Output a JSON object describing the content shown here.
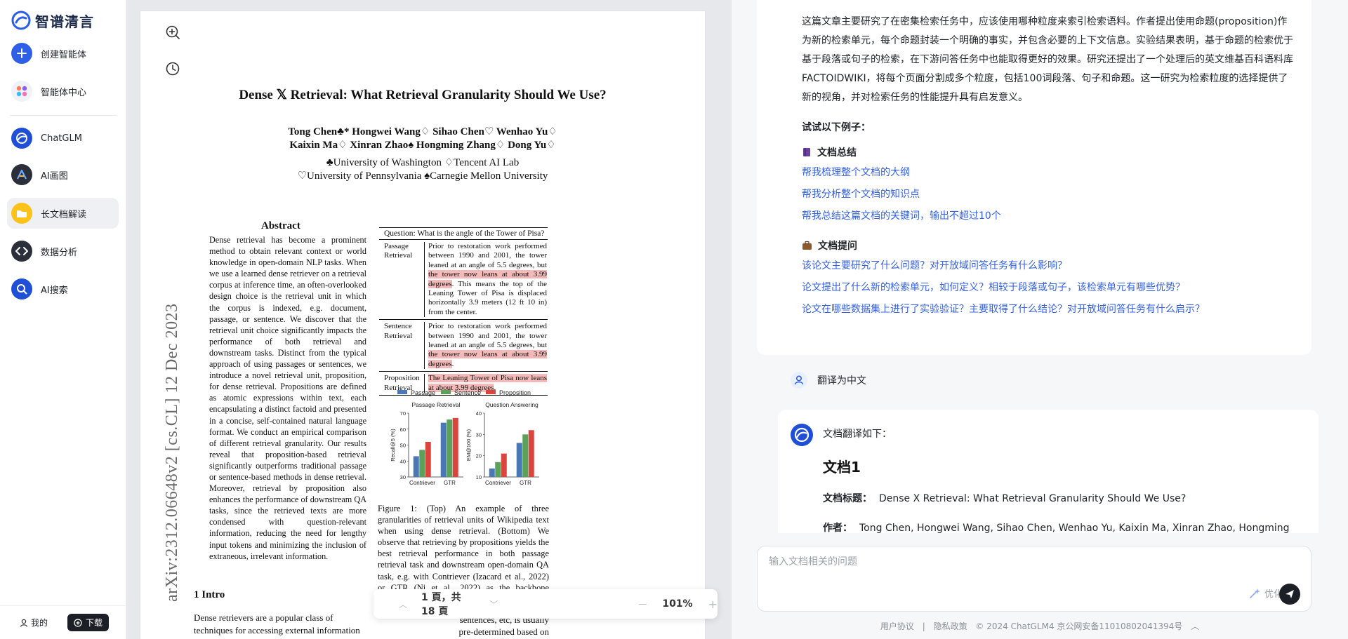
{
  "app": {
    "logo_text": "智谱清言"
  },
  "sidebar": {
    "items": [
      {
        "label": "创建智能体",
        "icon": "plus-icon"
      },
      {
        "label": "智能体中心",
        "icon": "agent-center-icon"
      },
      {
        "label": "ChatGLM",
        "icon": "chatglm-icon"
      },
      {
        "label": "AI画图",
        "icon": "ai-draw-icon"
      },
      {
        "label": "长文档解读",
        "icon": "folder-icon",
        "active": true
      },
      {
        "label": "数据分析",
        "icon": "code-icon"
      },
      {
        "label": "AI搜索",
        "icon": "search-icon"
      }
    ],
    "mine_label": "我的",
    "download_label": "下载"
  },
  "paper": {
    "title": "Dense 𝕏 Retrieval: What Retrieval Granularity Should We Use?",
    "authors_line1": "Tong Chen♣* Hongwei Wang♢ Sihao Chen♡ Wenhao Yu♢",
    "authors_line2": "Kaixin Ma♢ Xinran Zhao♠ Hongming Zhang♢ Dong Yu♢",
    "affiliation1": "♣University of Washington ♢Tencent AI Lab",
    "affiliation2": "♡University of Pennsylvania ♠Carnegie Mellon University",
    "arxiv_id": "arXiv:2312.06648v2  [cs.CL]  12 Dec 2023",
    "abstract_heading": "Abstract",
    "abstract": "Dense retrieval has become a prominent method to obtain relevant context or world knowledge in open-domain NLP tasks. When we use a learned dense retriever on a retrieval corpus at inference time, an often-overlooked design choice is the retrieval unit in which the corpus is indexed, e.g. document, passage, or sentence. We discover that the retrieval unit choice significantly impacts the performance of both retrieval and downstream tasks. Distinct from the typical approach of using passages or sentences, we introduce a novel retrieval unit, proposition, for dense retrieval. Propositions are defined as atomic expressions within text, each encapsulating a distinct factoid and presented in a concise, self-contained natural language format. We conduct an empirical comparison of different retrieval granularity. Our results reveal that proposition-based retrieval significantly outperforms traditional passage or sentence-based methods in dense retrieval. Moreover, retrieval by proposition also enhances the performance of downstream QA tasks, since the retrieved texts are more condensed with question-relevant information, reducing the need for lengthy input tokens and minimizing the inclusion of extraneous, irrelevant information.",
    "intro_heading": "1   Intro",
    "intro_text": "Dense retrievers are a popular class of techniques for accessing external information sources for",
    "figure": {
      "question": "Question: What is the angle of the Tower of Pisa?",
      "rows": [
        {
          "label": "Passage Retrieval",
          "text_plain": "Prior to restoration work performed between 1990 and 2001, the tower leaned at an angle of 5.5 degrees, but ",
          "text_hl": "the tower now leans at about 3.99 degrees",
          "text_after": ". This means the top of the Leaning Tower of Pisa is displaced horizontally 3.9 meters (12 ft 10 in) from the center."
        },
        {
          "label": "Sentence Retrieval",
          "text_plain": "Prior to restoration work performed between 1990 and 2001, the tower leaned at an angle of 5.5 degrees, but ",
          "text_hl": "the tower now leans at about 3.99 degrees",
          "text_after": "."
        },
        {
          "label": "Proposition Retrieval",
          "text_plain": "",
          "text_hl": "The Leaning Tower of Pisa now leans at about 3.99 degrees",
          "text_after": "."
        }
      ],
      "caption": "Figure 1: (Top) An example of three granularities of retrieval units of Wikipedia text when using dense retrieval. (Bottom) We observe that retrieving by propositions yields the best retrieval performance in both passage retrieval task and downstream open-domain QA task, e.g. with Contriever (Izacard et al., 2022) or GTR (Ni et al., 2022) as the backbone retriever. Highlight indicates the part that contains answer to the question.",
      "right_text": "e of re- assage chunks or sentences, etc, is usually pre-determined based on how the dense retrieval model is instanti-"
    }
  },
  "chart_data": {
    "type": "bar",
    "legend": [
      "Passage",
      "Sentence",
      "Proposition"
    ],
    "colors": [
      "#4a78b5",
      "#5aa25a",
      "#d9463f"
    ],
    "panels": [
      {
        "title": "Passage Retrieval",
        "ylabel": "Recall@5 (%)",
        "ylim": [
          30,
          70
        ],
        "yticks": [
          30,
          40,
          50,
          60,
          70
        ],
        "categories": [
          "Contriever",
          "GTR"
        ],
        "series": [
          {
            "name": "Passage",
            "values": [
              43,
              64
            ]
          },
          {
            "name": "Sentence",
            "values": [
              47,
              66
            ]
          },
          {
            "name": "Proposition",
            "values": [
              52,
              67
            ]
          }
        ]
      },
      {
        "title": "Question Answering",
        "ylabel": "EM@100 (%)",
        "ylim": [
          10,
          40
        ],
        "yticks": [
          10,
          20,
          30,
          40
        ],
        "categories": [
          "Contriever",
          "GTR"
        ],
        "series": [
          {
            "name": "Passage",
            "values": [
              14,
              26
            ]
          },
          {
            "name": "Sentence",
            "values": [
              17,
              30
            ]
          },
          {
            "name": "Proposition",
            "values": [
              21,
              32
            ]
          }
        ]
      }
    ]
  },
  "viewer": {
    "page_label": "1 頁，共 18 頁",
    "zoom_label": "101%",
    "minus": "—",
    "plus": "+"
  },
  "chat": {
    "summary": "这篇文章主要研究了在密集检索任务中，应该使用哪种粒度来索引检索语料。作者提出使用命题(proposition)作为新的检索单元，每个命题封装一个明确的事实，并包含必要的上下文信息。实验结果表明，基于命题的检索优于基于段落或句子的检索，在下游问答任务中也能取得更好的效果。研究还提出了一个处理后的英文维基百科语料库FACTOIDWIKI，将每个页面分割成多个粒度，包括100词段落、句子和命题。这一研究为检索粒度的选择提供了新的视角，并对检索任务的性能提升具有启发意义。",
    "try_label": "试试以下例子：",
    "sections": [
      {
        "title": "文档总结",
        "icon": "book-icon",
        "links": [
          "帮我梳理整个文档的大纲",
          "帮我分析整个文档的知识点",
          "帮我总结这篇文档的关键词，输出不超过10个"
        ]
      },
      {
        "title": "文档提问",
        "icon": "briefcase-icon",
        "links": [
          "该论文主要研究了什么问题？对开放域问答任务有什么影响？",
          "论文提出了什么新的检索单元，如何定义？相较于段落或句子，该检索单元有哪些优势？",
          "论文在哪些数据集上进行了实验验证？主要取得了什么结论？对开放域问答任务有什么启示？"
        ]
      }
    ],
    "user_message": "翻译为中文",
    "ai_lead": "文档翻译如下：",
    "doc_heading": "文档1",
    "doc_title_key": "文档标题：",
    "doc_title_value": "Dense X Retrieval: What Retrieval Granularity Should We Use?",
    "doc_author_key": "作者：",
    "doc_author_value": "Tong Chen, Hongwei Wang, Sihao Chen, Wenhao Yu, Kaixin Ma, Xinran Zhao, Hongming",
    "input_placeholder": "输入文档相关的问题",
    "optimize_label": "优化",
    "footer": [
      "用户协议",
      "|",
      "隐私政策",
      "© 2024 ChatGLM4 京公网安备11010802041394号"
    ]
  }
}
